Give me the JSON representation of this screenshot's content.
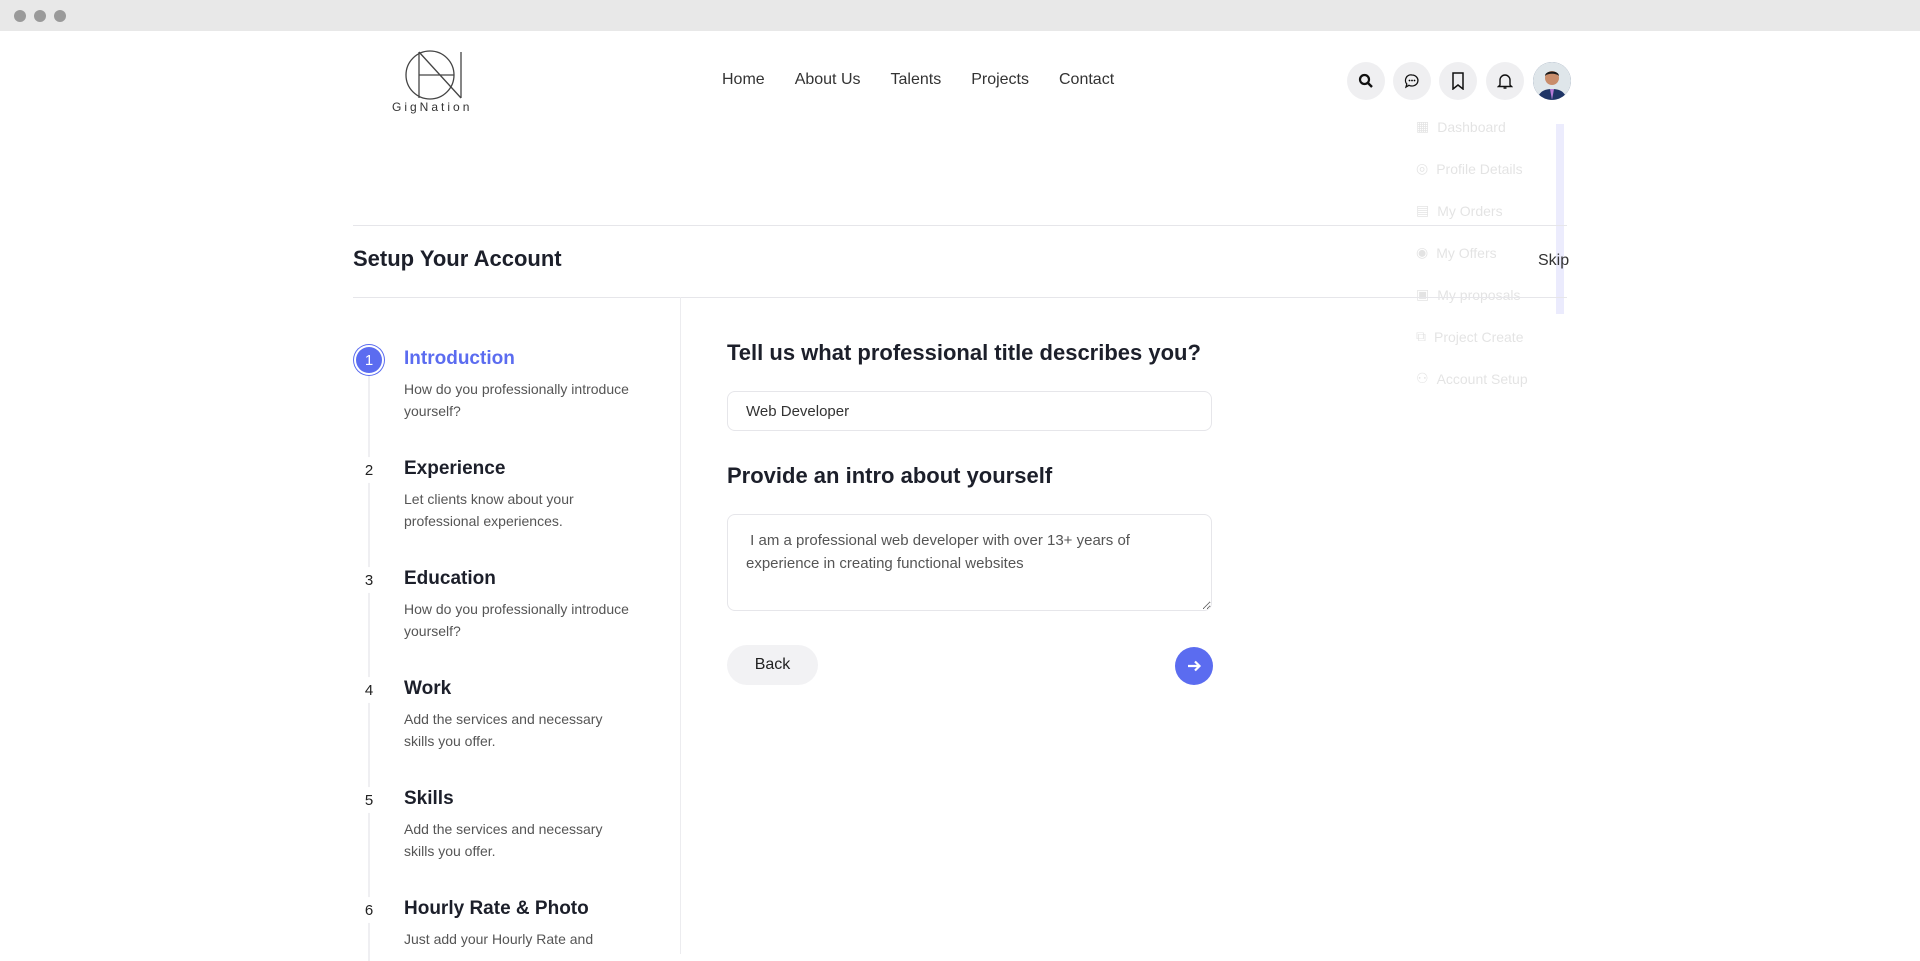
{
  "brand": {
    "name": "GigNation"
  },
  "nav": [
    "Home",
    "About Us",
    "Talents",
    "Projects",
    "Contact"
  ],
  "header_icons": [
    "search-icon",
    "chat-icon",
    "bookmark-icon",
    "bell-icon"
  ],
  "dropdown": [
    "Dashboard",
    "Profile Details",
    "My Orders",
    "My Offers",
    "My proposals",
    "Project Create",
    "Account Setup"
  ],
  "page": {
    "title": "Setup Your Account",
    "skip": "Skip"
  },
  "steps": [
    {
      "num": "1",
      "title": "Introduction",
      "desc": "How do you professionally introduce yourself?",
      "active": true
    },
    {
      "num": "2",
      "title": "Experience",
      "desc": "Let clients know about your professional experiences."
    },
    {
      "num": "3",
      "title": "Education",
      "desc": "How do you professionally introduce yourself?"
    },
    {
      "num": "4",
      "title": "Work",
      "desc": "Add the services and necessary skills you offer."
    },
    {
      "num": "5",
      "title": "Skills",
      "desc": "Add the services and necessary skills you offer."
    },
    {
      "num": "6",
      "title": "Hourly Rate & Photo",
      "desc": "Just add your Hourly Rate and"
    }
  ],
  "form": {
    "title_question": "Tell us what professional title describes you?",
    "title_value": "Web Developer",
    "intro_question": "Provide an intro about yourself",
    "intro_value": " I am a professional web developer with over 13+ years of experience in creating functional websites",
    "back_label": "Back"
  },
  "colors": {
    "accent": "#5b6cf0"
  }
}
